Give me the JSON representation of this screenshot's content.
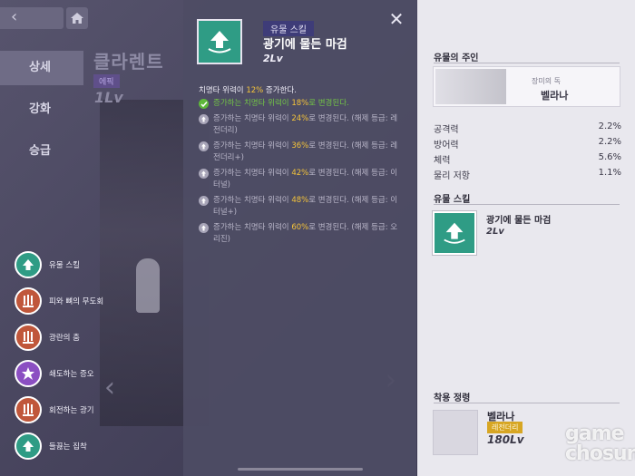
{
  "nav": {
    "back_icon": "chevron-left-icon",
    "home_icon": "home-icon"
  },
  "side_menu": [
    {
      "label": "상세"
    },
    {
      "label": "강화"
    },
    {
      "label": "승급"
    }
  ],
  "character": {
    "name": "클라렌트",
    "badge": "에픽",
    "level": "1Lv"
  },
  "skills": [
    {
      "label": "유물 스킬",
      "color": "#2f9c85"
    },
    {
      "label": "피와 뼈의 무도회",
      "color": "#c0573b"
    },
    {
      "label": "광란의 춤",
      "color": "#c0573b"
    },
    {
      "label": "쇄도하는 증오",
      "color": "#8b4fc2"
    },
    {
      "label": "회전하는 광기",
      "color": "#c0573b"
    },
    {
      "label": "들끓는 집착",
      "color": "#2f9c85"
    }
  ],
  "popup": {
    "type_tag": "유물 스킬",
    "title": "광기에 물든 마검",
    "level": "2Lv",
    "description_prefix": "치명타 위력이 ",
    "description_value": "12%",
    "description_suffix": " 증가한다.",
    "upgrades": [
      {
        "prefix": "증가하는 치명타 위력이 ",
        "value": "18%",
        "suffix": "로 변경된다.",
        "done": true
      },
      {
        "prefix": "증가하는 치명타 위력이 ",
        "value": "24%",
        "suffix": "로 변경된다. (해제 등급: 레전더리)",
        "done": false
      },
      {
        "prefix": "증가하는 치명타 위력이 ",
        "value": "36%",
        "suffix": "로 변경된다. (해제 등급: 레전더리+)",
        "done": false
      },
      {
        "prefix": "증가하는 치명타 위력이 ",
        "value": "42%",
        "suffix": "로 변경된다. (해제 등급: 이터널)",
        "done": false
      },
      {
        "prefix": "증가하는 치명타 위력이 ",
        "value": "48%",
        "suffix": "로 변경된다. (해제 등급: 이터널+)",
        "done": false
      },
      {
        "prefix": "증가하는 치명타 위력이 ",
        "value": "60%",
        "suffix": "로 변경된다. (해제 등급: 오리진)",
        "done": false
      }
    ]
  },
  "right_panel": {
    "owner_title": "유물의 주인",
    "owner_subtitle": "장미의 독",
    "owner_name": "벨라나",
    "stats": [
      {
        "name": "공격력",
        "value": "2.2%"
      },
      {
        "name": "방어력",
        "value": "2.2%"
      },
      {
        "name": "체력",
        "value": "5.6%"
      },
      {
        "name": "물리 저항",
        "value": "1.1%"
      }
    ],
    "skill_title": "유물 스킬",
    "skill_name": "광기에 물든 마검",
    "skill_level": "2Lv",
    "equip_title": "착용 정령",
    "equip_name": "벨라나",
    "equip_rank": "레전더리",
    "equip_level": "180Lv"
  },
  "watermark": {
    "line1": "game",
    "line2": "chosun"
  },
  "colors": {
    "accent_teal": "#2f9c85",
    "highlight_yellow": "#f5c43a",
    "done_green": "#73c546"
  }
}
